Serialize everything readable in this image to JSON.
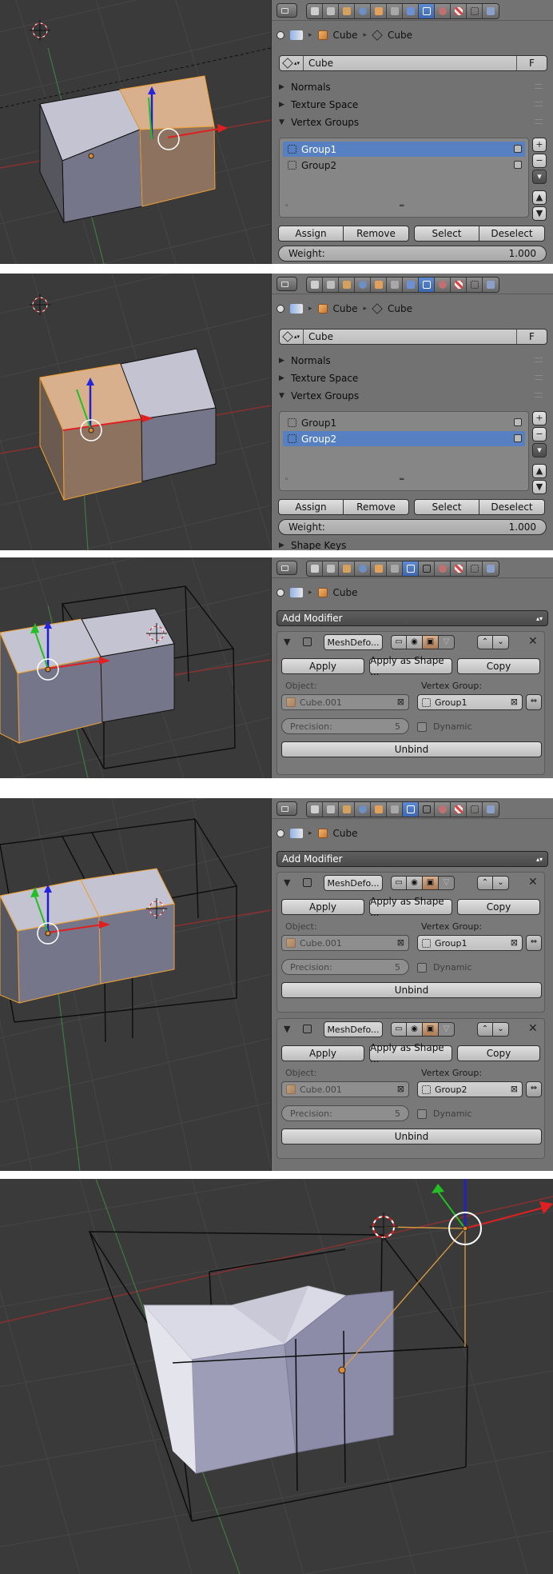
{
  "panels": [
    {
      "kind": "vertex_groups",
      "breadcrumb": [
        "Cube",
        "Cube"
      ],
      "mesh_field": {
        "name": "Cube",
        "fake_user": "F"
      },
      "sections": [
        {
          "label": "Normals",
          "open": false
        },
        {
          "label": "Texture Space",
          "open": false
        },
        {
          "label": "Vertex Groups",
          "open": true
        }
      ],
      "groups": [
        {
          "name": "Group1",
          "selected": true
        },
        {
          "name": "Group2",
          "selected": false
        }
      ],
      "side_buttons": [
        "+",
        "−",
        "▾",
        "▲",
        "▼"
      ],
      "buttons": {
        "assign": "Assign",
        "remove": "Remove",
        "select": "Select",
        "deselect": "Deselect"
      },
      "weight": {
        "label": "Weight:",
        "value": "1.000"
      }
    },
    {
      "kind": "vertex_groups",
      "breadcrumb": [
        "Cube",
        "Cube"
      ],
      "mesh_field": {
        "name": "Cube",
        "fake_user": "F"
      },
      "sections": [
        {
          "label": "Normals",
          "open": false
        },
        {
          "label": "Texture Space",
          "open": false
        },
        {
          "label": "Vertex Groups",
          "open": true
        }
      ],
      "groups": [
        {
          "name": "Group1",
          "selected": false
        },
        {
          "name": "Group2",
          "selected": true
        }
      ],
      "side_buttons": [
        "+",
        "−",
        "▾",
        "▲",
        "▼"
      ],
      "buttons": {
        "assign": "Assign",
        "remove": "Remove",
        "select": "Select",
        "deselect": "Deselect"
      },
      "weight": {
        "label": "Weight:",
        "value": "1.000"
      },
      "cut_section": "Shape Keys"
    },
    {
      "kind": "modifiers",
      "breadcrumb": [
        "Cube"
      ],
      "add_modifier": "Add Modifier",
      "modifiers": [
        {
          "name": "MeshDefo...",
          "apply": "Apply",
          "apply_shape": "Apply as Shape ...",
          "copy": "Copy",
          "object_label": "Object:",
          "object_value": "Cube.001",
          "vgroup_label": "Vertex Group:",
          "vgroup_value": "Group1",
          "precision_label": "Precision:",
          "precision_value": "5",
          "dynamic_label": "Dynamic",
          "unbind": "Unbind"
        }
      ]
    },
    {
      "kind": "modifiers",
      "breadcrumb": [
        "Cube"
      ],
      "add_modifier": "Add Modifier",
      "modifiers": [
        {
          "name": "MeshDefo...",
          "apply": "Apply",
          "apply_shape": "Apply as Shape ...",
          "copy": "Copy",
          "object_label": "Object:",
          "object_value": "Cube.001",
          "vgroup_label": "Vertex Group:",
          "vgroup_value": "Group1",
          "precision_label": "Precision:",
          "precision_value": "5",
          "dynamic_label": "Dynamic",
          "unbind": "Unbind"
        },
        {
          "name": "MeshDefo...",
          "apply": "Apply",
          "apply_shape": "Apply as Shape ...",
          "copy": "Copy",
          "object_label": "Object:",
          "object_value": "Cube.001",
          "vgroup_label": "Vertex Group:",
          "vgroup_value": "Group2",
          "precision_label": "Precision:",
          "precision_value": "5",
          "dynamic_label": "Dynamic",
          "unbind": "Unbind"
        }
      ]
    }
  ],
  "colors": {
    "viewport_bg": "#3a3a3a",
    "panel_bg": "#727272",
    "selection_blue": "#5680c2",
    "mesh_face": "#b9b9c9",
    "selected_outline": "#f0a030"
  }
}
